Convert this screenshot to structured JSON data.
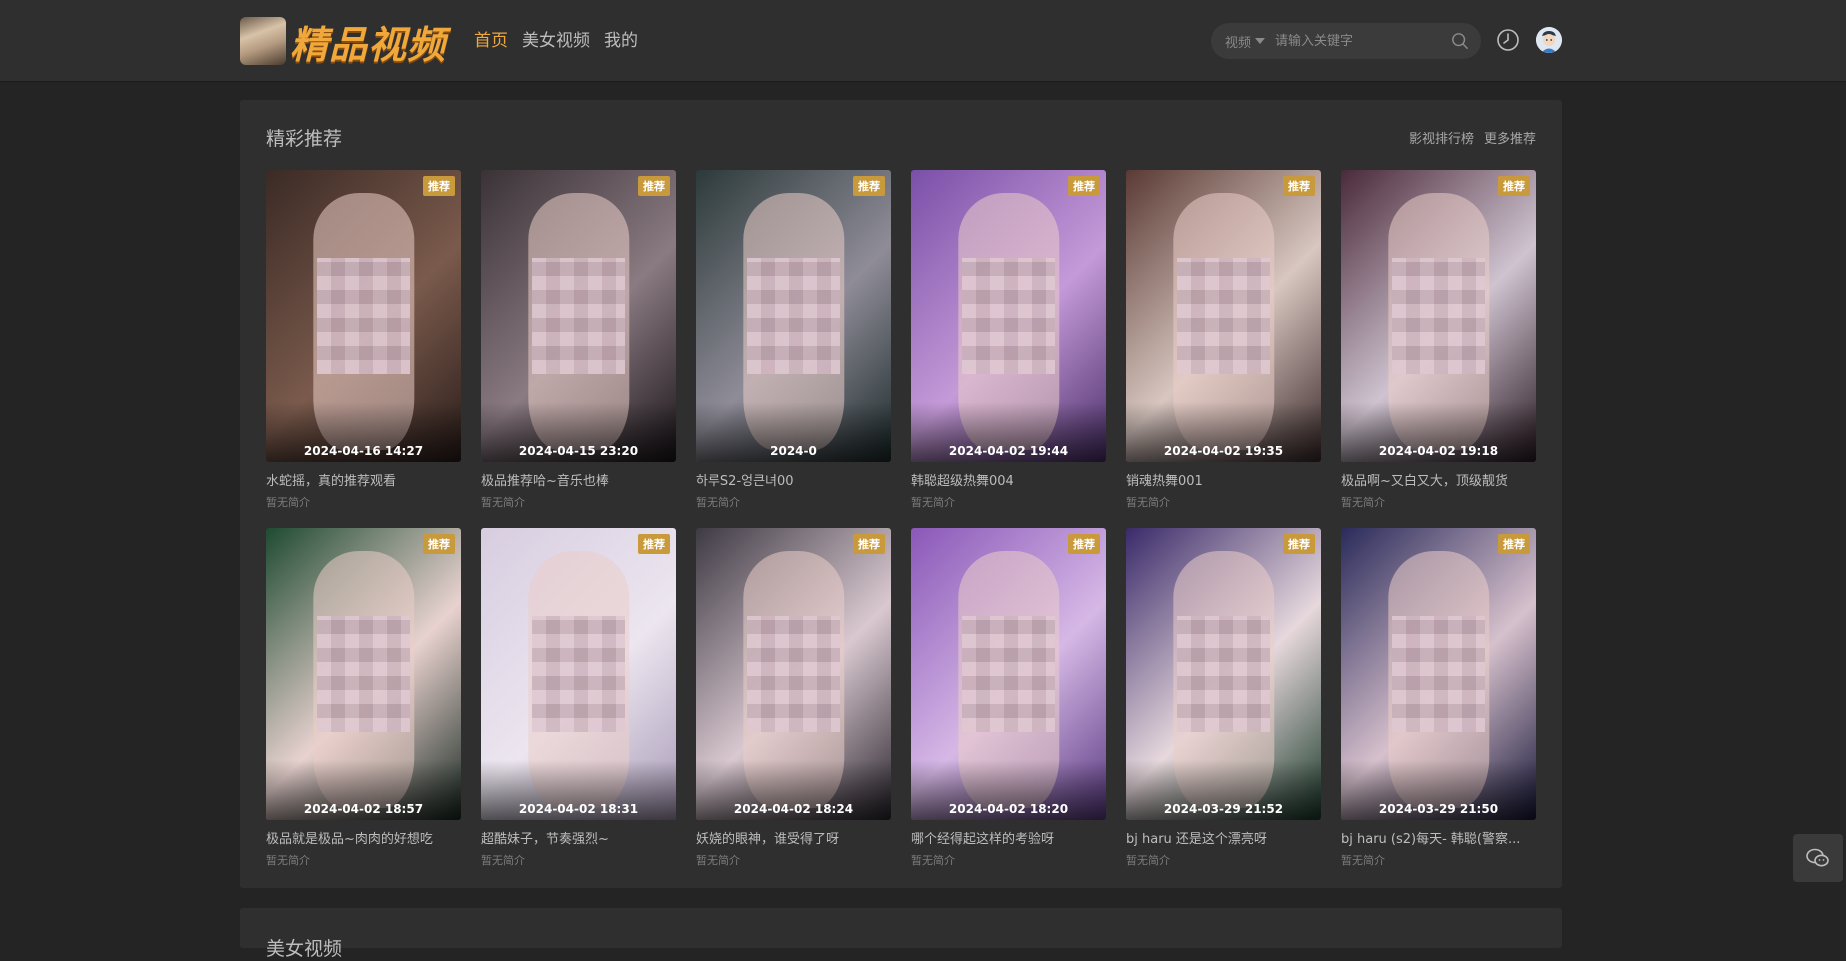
{
  "header": {
    "logo_text": "精品视频",
    "nav": [
      {
        "label": "首页",
        "active": true
      },
      {
        "label": "美女视频",
        "active": false
      },
      {
        "label": "我的",
        "active": false
      }
    ],
    "search": {
      "category": "视频",
      "placeholder": "请输入关键字"
    }
  },
  "section": {
    "title": "精彩推荐",
    "links": [
      "影视排行榜",
      "更多推荐"
    ]
  },
  "badge_label": "推荐",
  "cards": [
    {
      "date": "2024-04-16 14:27",
      "title": "水蛇摇，真的推荐观看",
      "desc": "暂无简介",
      "bg": [
        "#3b2a25",
        "#7a5a4c",
        "#2a1d1a"
      ]
    },
    {
      "date": "2024-04-15 23:20",
      "title": "极品推荐哈~音乐也棒",
      "desc": "暂无简介",
      "bg": [
        "#3a3236",
        "#8a7a82",
        "#1a1518"
      ]
    },
    {
      "date": "2024-0",
      "title": "하루S2-엉큰녀00",
      "desc": "暂无简介",
      "bg": [
        "#2c3a3a",
        "#8f8c98",
        "#1c2a2a"
      ]
    },
    {
      "date": "2024-04-02 19:44",
      "title": "韩聪超级热舞004",
      "desc": "暂无简介",
      "bg": [
        "#7a4fa8",
        "#c59ad8",
        "#4a2f6a"
      ]
    },
    {
      "date": "2024-04-02 19:35",
      "title": "销魂热舞001",
      "desc": "暂无简介",
      "bg": [
        "#5a3a34",
        "#d8c6c0",
        "#3a2a2a"
      ]
    },
    {
      "date": "2024-04-02 19:18",
      "title": "极品啊~又白又大，顶级靓货",
      "desc": "暂无简介",
      "bg": [
        "#4a2a3a",
        "#cfc3d0",
        "#2a1a22"
      ]
    },
    {
      "date": "2024-04-02 18:57",
      "title": "极品就是极品~肉肉的好想吃",
      "desc": "暂无简介",
      "bg": [
        "#1f4a32",
        "#e8d2cf",
        "#1a2a22"
      ]
    },
    {
      "date": "2024-04-02 18:31",
      "title": "超酷妹子，节奏强烈~",
      "desc": "暂无简介",
      "bg": [
        "#d7cde0",
        "#ece6f0",
        "#a89ab6"
      ]
    },
    {
      "date": "2024-04-02 18:24",
      "title": "妖娆的眼神，谁受得了呀",
      "desc": "暂无简介",
      "bg": [
        "#3e3a44",
        "#d9c8d0",
        "#2a262e"
      ]
    },
    {
      "date": "2024-04-02 18:20",
      "title": "哪个经得起这样的考验呀",
      "desc": "暂无简介",
      "bg": [
        "#8a58b8",
        "#d6b8e6",
        "#5a3a82"
      ]
    },
    {
      "date": "2024-03-29 21:52",
      "title": "bj haru 还是这个漂亮呀",
      "desc": "暂无简介",
      "bg": [
        "#3a2a6a",
        "#e6d8dc",
        "#1a3a2a"
      ]
    },
    {
      "date": "2024-03-29 21:50",
      "title": "bj haru (s2)每天- 韩聪(警察...",
      "desc": "暂无简介",
      "bg": [
        "#2a2a5a",
        "#d6c0cc",
        "#18183a"
      ]
    }
  ],
  "section2_title": "美女视频"
}
